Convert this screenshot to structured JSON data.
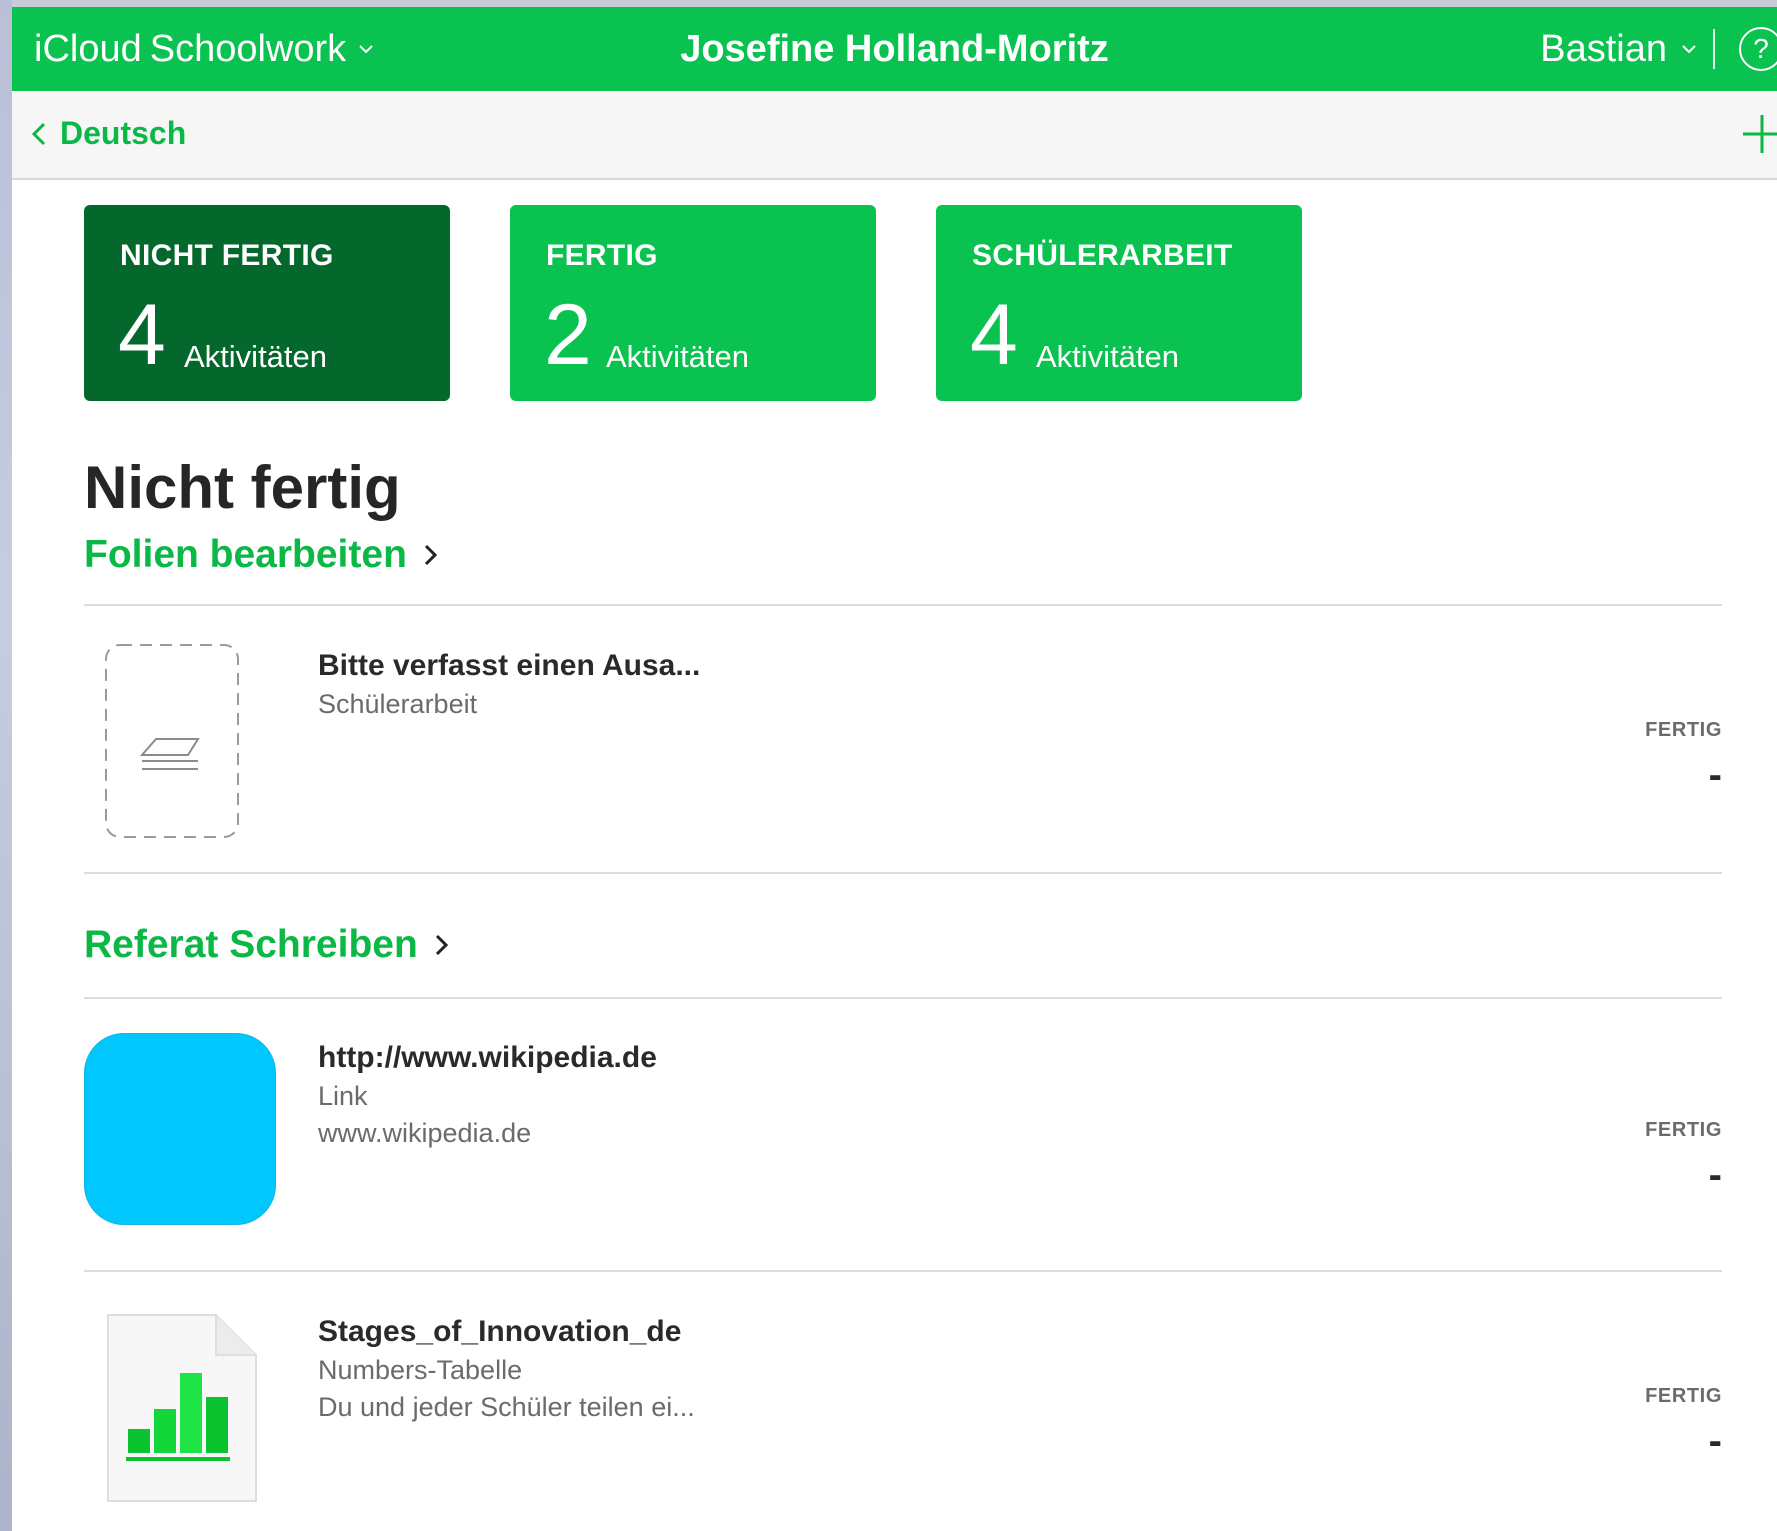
{
  "topbar": {
    "app_name_brand": "iCloud",
    "app_name_rest": "Schoolwork",
    "student_name": "Josefine Holland-Moritz",
    "user_name": "Bastian",
    "help_label": "?",
    "color": "#0ac24f"
  },
  "nav": {
    "back_label": "Deutsch"
  },
  "cards": [
    {
      "label": "NICHT FERTIG",
      "count": "4",
      "unit": "Aktivitäten",
      "color": "#04672b"
    },
    {
      "label": "FERTIG",
      "count": "2",
      "unit": "Aktivitäten",
      "color": "#0ac24f"
    },
    {
      "label": "SCHÜLERARBEIT",
      "count": "4",
      "unit": "Aktivitäten",
      "color": "#0ac24f"
    }
  ],
  "section_title": "Nicht fertig",
  "groups": [
    {
      "title": "Folien bearbeiten",
      "items": [
        {
          "title": "Bitte verfasst einen Ausa...",
          "type": "Schülerarbeit",
          "detail": "",
          "status_label": "FERTIG",
          "status_value": "-",
          "icon": "student-work-placeholder-icon"
        }
      ]
    },
    {
      "title": "Referat Schreiben",
      "items": [
        {
          "title": "http://www.wikipedia.de",
          "type": "Link",
          "detail": "www.wikipedia.de",
          "status_label": "FERTIG",
          "status_value": "-",
          "icon": "link-thumbnail-icon"
        },
        {
          "title": "Stages_of_Innovation_de",
          "type": "Numbers-Tabelle",
          "detail": "Du und jeder Schüler teilen ei...",
          "status_label": "FERTIG",
          "status_value": "-",
          "icon": "numbers-document-icon"
        }
      ]
    }
  ]
}
